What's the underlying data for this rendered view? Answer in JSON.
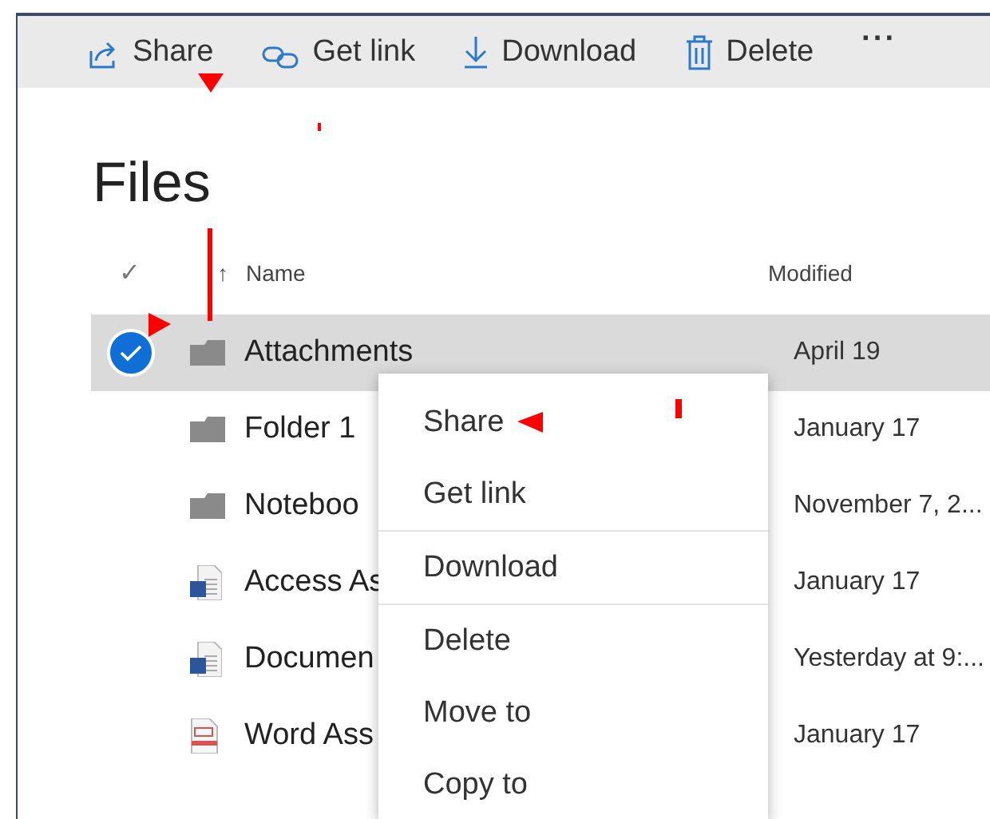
{
  "toolbar": [
    {
      "label": "Share"
    },
    {
      "label": "Get link"
    },
    {
      "label": "Download"
    },
    {
      "label": "Delete"
    },
    {
      "label": "···"
    }
  ],
  "title": "Files",
  "columns": {
    "select": "✓",
    "name_sort": "↑",
    "name": "Name",
    "modified": "Modified"
  },
  "rows": [
    {
      "name": "Attachments",
      "modified": "April 19",
      "kind": "folder",
      "selected": true
    },
    {
      "name": "Folder 1",
      "modified": "January 17",
      "kind": "folder",
      "selected": false
    },
    {
      "name": "Noteboo",
      "modified": "November 7, 2...",
      "kind": "folder",
      "selected": false
    },
    {
      "name": "Access As",
      "modified": "January 17",
      "kind": "word",
      "selected": false
    },
    {
      "name": "Documen",
      "modified": "Yesterday at 9:...",
      "kind": "word",
      "selected": false
    },
    {
      "name": "Word Ass",
      "modified": "January 17",
      "kind": "pdf",
      "selected": false
    }
  ],
  "context_menu": [
    {
      "label": "Share",
      "divider_after": false
    },
    {
      "label": "Get link",
      "divider_after": true
    },
    {
      "label": "Download",
      "divider_after": true
    },
    {
      "label": "Delete",
      "divider_after": false
    },
    {
      "label": "Move to",
      "divider_after": false
    },
    {
      "label": "Copy to",
      "divider_after": false
    }
  ]
}
